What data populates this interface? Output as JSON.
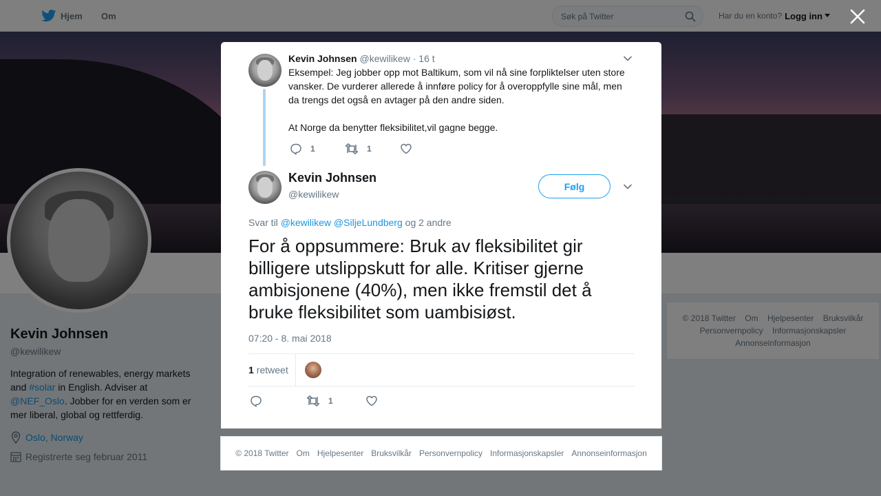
{
  "topbar": {
    "home_label": "Hjem",
    "about_label": "Om",
    "search_placeholder": "Søk på Twitter",
    "account_prompt": "Har du en konto?",
    "login_label": "Logg inn"
  },
  "profile": {
    "name": "Kevin Johnsen",
    "handle": "@kewilikew",
    "bio_1": "Integration of renewables, energy markets and ",
    "bio_hashtag": "#solar",
    "bio_2": " in English. Adviser at ",
    "bio_mention": "@NEF_Oslo",
    "bio_3": ". Jobber for en verden som er mer liberal, global og rettferdig.",
    "location": "Oslo, Norway",
    "joined": "Registrerte seg februar 2011"
  },
  "side_footer": {
    "links": [
      "© 2018 Twitter",
      "Om",
      "Hjelpesenter",
      "Bruksvilkår",
      "Personvernpolicy",
      "Informasjonskapsler",
      "Annonseinformasjon"
    ]
  },
  "parent_tweet": {
    "name": "Kevin Johnsen",
    "handle": "@kewilikew",
    "sep": "·",
    "time": "16 t",
    "paragraph_1": "Eksempel: Jeg jobber opp mot Baltikum, som vil nå sine forpliktelser uten store vansker.  De vurderer allerede å innføre policy for å overoppfylle sine mål, men da trengs det også en avtager på den andre siden.",
    "paragraph_2": "At Norge da benytter fleksibilitet,vil gagne begge.",
    "reply_count": "1",
    "retweet_count": "1"
  },
  "main_tweet": {
    "name": "Kevin Johnsen",
    "handle": "@kewilikew",
    "follow_label": "Følg",
    "reply_prefix": "Svar til",
    "reply_user_1": "@kewilikew",
    "reply_user_2": "@SiljeLundberg",
    "reply_suffix": "og 2 andre",
    "text": "For å oppsummere: Bruk av fleksibilitet gir billigere utslippskutt for alle. Kritiser gjerne ambisjonene (40%), men ikke fremstil det å bruke fleksibilitet som uambisiøst.",
    "timestamp": "07:20 - 8. mai 2018",
    "retweet_stat_count": "1",
    "retweet_stat_label": "retweet",
    "retweet_count": "1"
  },
  "footer": {
    "links": [
      "© 2018 Twitter",
      "Om",
      "Hjelpesenter",
      "Bruksvilkår",
      "Personvernpolicy",
      "Informasjonskapsler",
      "Annonseinformasjon"
    ]
  },
  "icons": {
    "brand": "twitter-bird-icon",
    "search": "search-icon",
    "close": "close-icon",
    "reply": "reply-icon",
    "retweet": "retweet-icon",
    "like": "heart-icon",
    "more": "chevron-down-icon",
    "location": "location-pin-icon",
    "calendar": "calendar-icon"
  },
  "colors": {
    "accent": "#1da1f2",
    "link": "#1b95e0",
    "thread_line": "#a9d6f5",
    "muted_text": "#657786"
  }
}
